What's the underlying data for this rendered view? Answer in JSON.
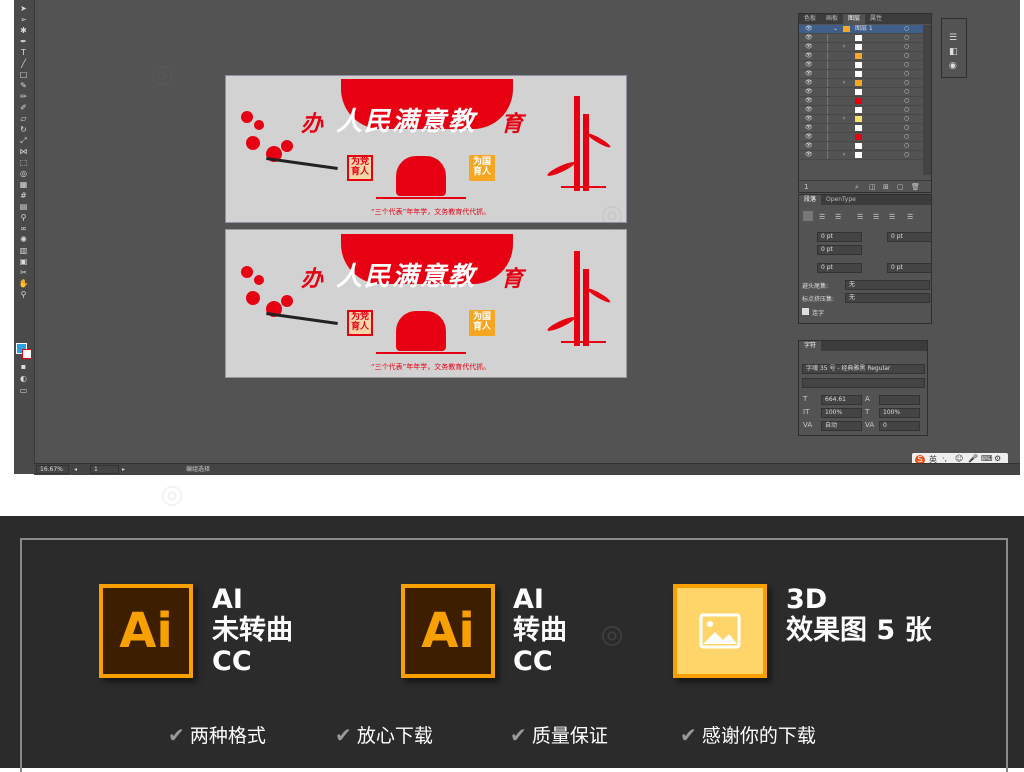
{
  "panels": {
    "layers": {
      "tabs": [
        "色板",
        "画板",
        "图层",
        "属性"
      ],
      "active_tab": "图层",
      "top_layer": "图层 1",
      "swatch_colors": [
        "#ffffff",
        "#ffffff",
        "#f5a623",
        "#ffffff",
        "#ffffff",
        "#f5a623",
        "#ffffff",
        "#e60012",
        "#ffffff",
        "#f5e06a",
        "#ffffff",
        "#e60012",
        "#ffffff",
        "#ffffff"
      ]
    },
    "paragraph": {
      "tabs": [
        "段落",
        "OpenType"
      ],
      "fields": [
        "0 pt",
        "0 pt",
        "0 pt",
        "0 pt",
        "0 pt"
      ],
      "hyphen_label": "避头尾集:",
      "hyphen_value": "无",
      "punct_label": "标点挤压集:",
      "punct_value": "无",
      "connect_label": "连字"
    },
    "character": {
      "tab": "字符",
      "font_name": "字魂 35 号 - 经典雅黑 Regular",
      "font_size": "664.61",
      "vscale": "100%",
      "hscale": "100%",
      "leading": "自动",
      "tracking": "0"
    }
  },
  "statusbar": {
    "zoom": "16.67%",
    "artboard": "1",
    "tool_label": "编组选择"
  },
  "artwork": {
    "red_char": "办",
    "title": "人民满意教",
    "red_char_end": "育",
    "stamp_left_line1": "为党",
    "stamp_left_line2": "育人",
    "stamp_right_line1": "为国",
    "stamp_right_line2": "育人",
    "slogan": "“三个代表”年年学，文务教育代代抓。"
  },
  "promo": {
    "items": [
      {
        "icon": "Ai",
        "line1": "AI",
        "line2": "未转曲",
        "line3": "CC"
      },
      {
        "icon": "Ai",
        "line1": "AI",
        "line2": "转曲",
        "line3": "CC"
      },
      {
        "icon": "image-icon",
        "line1": "3D",
        "line2": "效果图 5 张"
      }
    ],
    "features": [
      "两种格式",
      "放心下载",
      "质量保证",
      "感谢你的下载"
    ]
  },
  "colors": {
    "accent_red": "#e60012",
    "ai_orange": "#f7a000",
    "ai_brown": "#3d1f00",
    "promo_bg": "#2b2b2b"
  }
}
